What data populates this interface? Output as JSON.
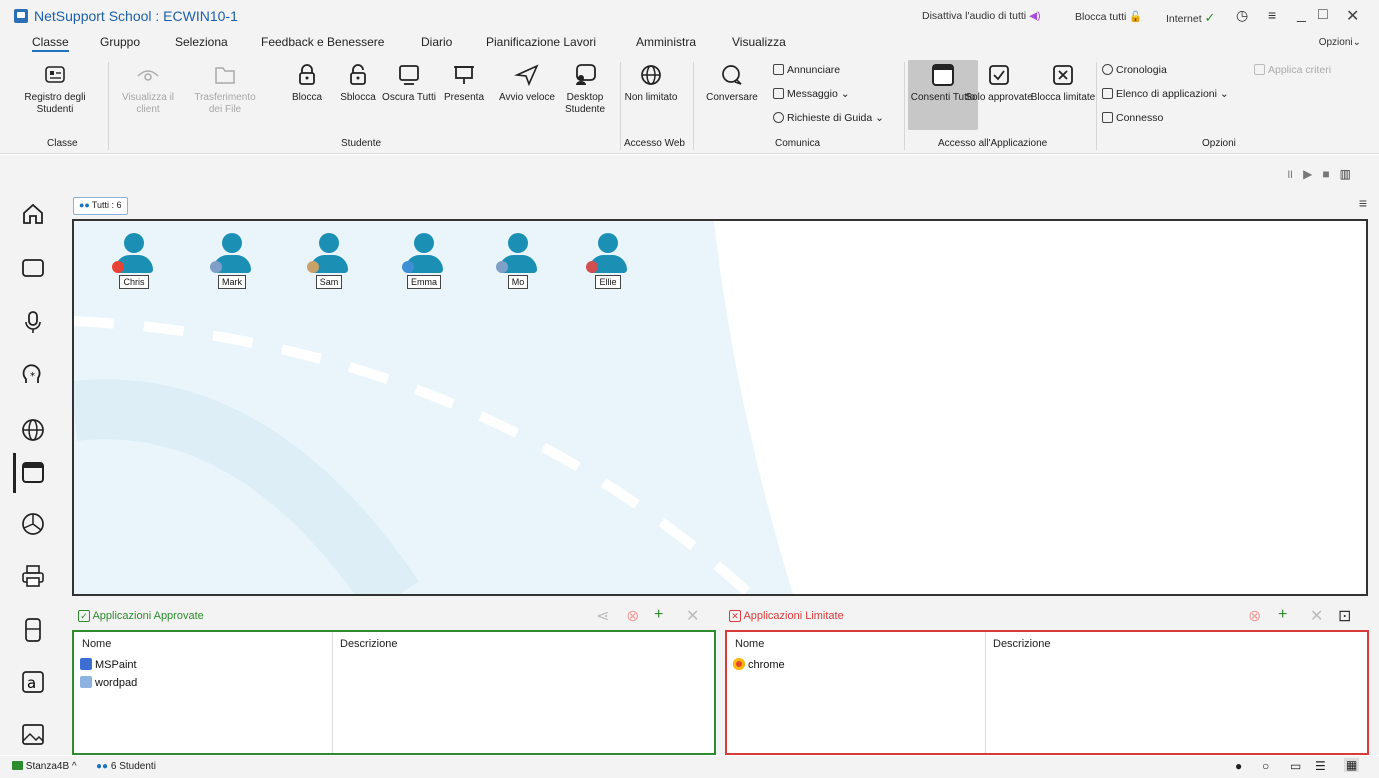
{
  "window": {
    "title": "NetSupport School : ECWIN10-1",
    "mute_all": "Disattiva l'audio di tutti",
    "lock_all": "Blocca tutti",
    "internet": "Internet",
    "controls": [
      "_",
      "□",
      "✕"
    ]
  },
  "tabs": [
    "Classe",
    "Gruppo",
    "Seleziona",
    "Feedback e Benessere",
    "Diario",
    "Pianificazione Lavori",
    "Amministra",
    "Visualizza"
  ],
  "options_menu": "Opzioni",
  "ribbon": {
    "registro": "Registro degli Studenti",
    "visualizza": "Visualizza il client",
    "trasferimento": "Trasferimento dei File",
    "blocca": "Blocca",
    "sblocca": "Sblocca",
    "oscura": "Oscura Tutti",
    "presenta": "Presenta",
    "avvio": "Avvio veloce",
    "desktop": "Desktop Studente",
    "non_limitato": "Non limitato",
    "conversare": "Conversare",
    "annunciare": "Annunciare",
    "messaggio": "Messaggio",
    "richieste": "Richieste di Guida",
    "consenti": "Consenti Tutto",
    "solo": "Solo approvate",
    "blocca_limitate": "Blocca limitate",
    "cronologia": "Cronologia",
    "elenco": "Elenco di applicazioni",
    "connesso": "Connesso",
    "applica": "Applica criteri",
    "groups": {
      "classe": "Classe",
      "studente": "Studente",
      "accesso_web": "Accesso Web",
      "comunica": "Comunica",
      "accesso_app": "Accesso all'Applicazione",
      "opzioni": "Opzioni"
    }
  },
  "group_tab": "Tutti : 6",
  "students": [
    {
      "name": "Chris",
      "badge": "#e94235"
    },
    {
      "name": "Mark",
      "badge": "#7f9fc9"
    },
    {
      "name": "Sam",
      "badge": "#c9a26a"
    },
    {
      "name": "Emma",
      "badge": "#3d8fd6"
    },
    {
      "name": "Mo",
      "badge": "#7f9fc9"
    },
    {
      "name": "Ellie",
      "badge": "#d04f4f"
    }
  ],
  "approved": {
    "title": "Applicazioni Approvate",
    "col_name": "Nome",
    "col_desc": "Descrizione",
    "rows": [
      "MSPaint",
      "wordpad"
    ],
    "color": "#2e8b2e"
  },
  "restricted": {
    "title": "Applicazioni Limitate",
    "col_name": "Nome",
    "col_desc": "Descrizione",
    "rows": [
      "chrome"
    ],
    "color": "#d93a3a"
  },
  "status": {
    "room": "Stanza4B",
    "students": "6 Studenti"
  }
}
